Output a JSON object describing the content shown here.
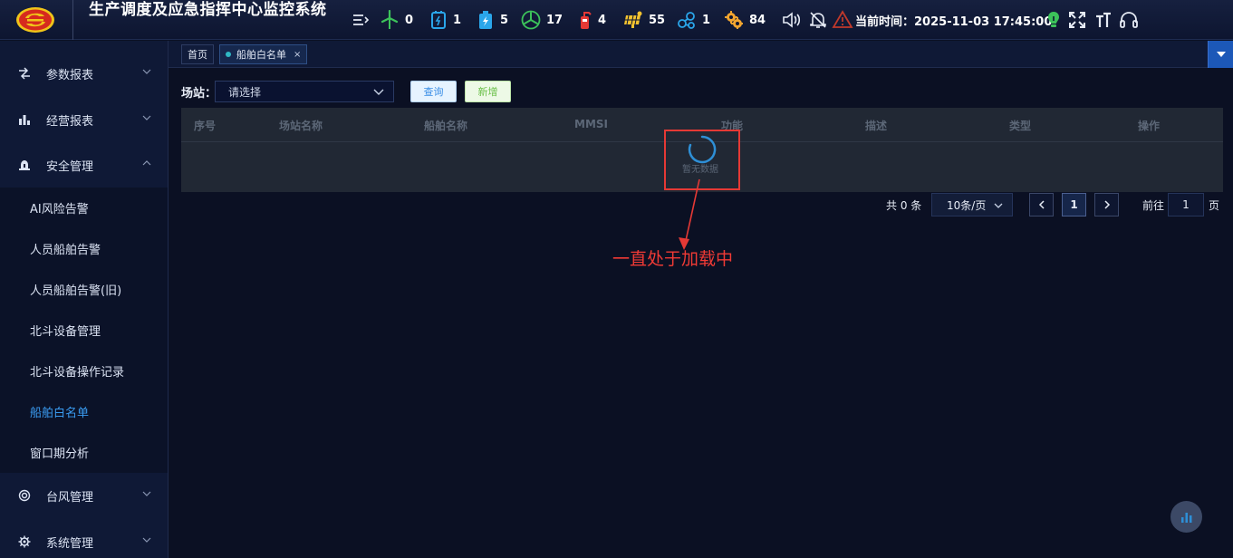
{
  "header": {
    "title": "生产调度及应急指挥中心监控系统",
    "stats": [
      {
        "icon": "wind-turbine-icon",
        "value": "0",
        "color": "#3cc25a"
      },
      {
        "icon": "inverter-icon",
        "value": "1",
        "color": "#2aa6ea"
      },
      {
        "icon": "battery-charge-icon",
        "value": "5",
        "color": "#2aa6ea"
      },
      {
        "icon": "fan-circle-icon",
        "value": "17",
        "color": "#3cc25a"
      },
      {
        "icon": "fire-extinguisher-icon",
        "value": "4",
        "color": "#e53935"
      },
      {
        "icon": "solar-panel-icon",
        "value": "55",
        "color": "#f2c230"
      },
      {
        "icon": "network-nodes-icon",
        "value": "1",
        "color": "#2aa6ea"
      },
      {
        "icon": "gear-cluster-icon",
        "value": "84",
        "color": "#f2a530"
      }
    ],
    "time_label": "当前时间：",
    "time_value": "2025-11-03 17:45:00"
  },
  "sidebar": {
    "items": [
      {
        "label": "参数报表",
        "icon": "arrows-exchange-icon"
      },
      {
        "label": "经营报表",
        "icon": "bar-chart-icon"
      },
      {
        "label": "安全管理",
        "icon": "alarm-light-icon"
      },
      {
        "label": "台风管理",
        "icon": "typhoon-icon"
      },
      {
        "label": "系统管理",
        "icon": "gear-icon"
      }
    ],
    "sub_items": [
      {
        "label": "AI风险告警"
      },
      {
        "label": "人员船舶告警"
      },
      {
        "label": "人员船舶告警(旧)"
      },
      {
        "label": "北斗设备管理"
      },
      {
        "label": "北斗设备操作记录"
      },
      {
        "label": "船舶白名单"
      },
      {
        "label": "窗口期分析"
      }
    ]
  },
  "tabs": {
    "home": "首页",
    "current": "船舶白名单",
    "close": "×"
  },
  "filter": {
    "label": "场站：",
    "placeholder": "请选择",
    "query_button": "查询",
    "add_button": "新增"
  },
  "table": {
    "columns": [
      "序号",
      "场站名称",
      "船舶名称",
      "MMSI",
      "功能",
      "描述",
      "类型",
      "操作"
    ],
    "empty_text": "暂无数据"
  },
  "pagination": {
    "total": "共 0 条",
    "page_size": "10条/页",
    "current_page": "1",
    "goto_label": "前往",
    "goto_value": "1",
    "page_suffix": "页"
  },
  "annotation": {
    "text": "一直处于加载中",
    "color": "#e53935"
  }
}
